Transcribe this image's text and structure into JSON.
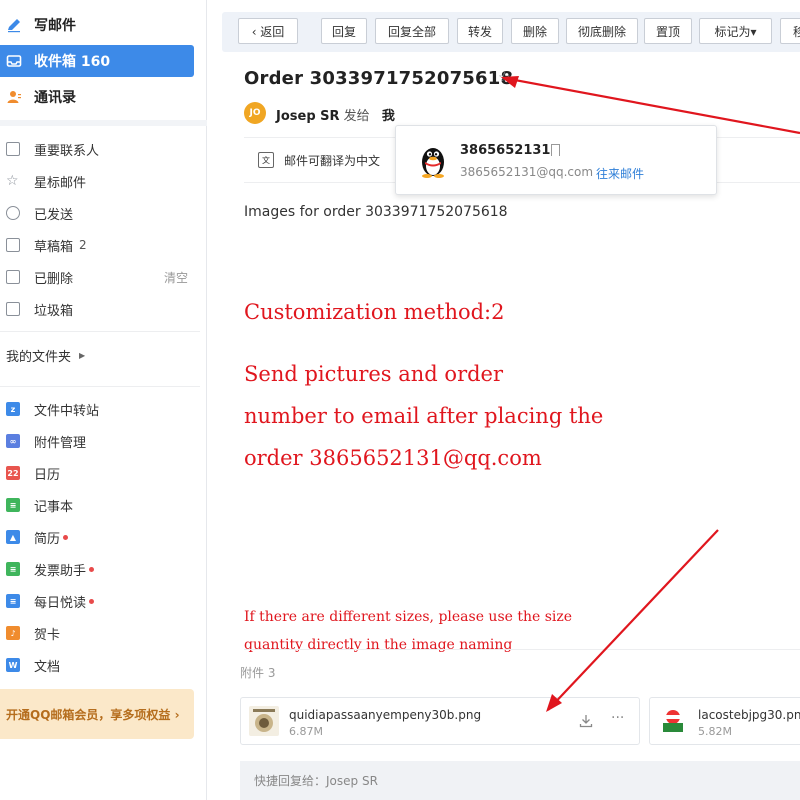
{
  "sidebar": {
    "compose": "写邮件",
    "inbox": "收件箱 160",
    "contacts": "通讯录",
    "folders": [
      {
        "label": "重要联系人",
        "count": "",
        "action": ""
      },
      {
        "label": "星标邮件",
        "count": "",
        "action": ""
      },
      {
        "label": "已发送",
        "count": "",
        "action": ""
      },
      {
        "label": "草稿箱",
        "count": "2",
        "action": ""
      },
      {
        "label": "已删除",
        "count": "",
        "action": "清空"
      },
      {
        "label": "垃圾箱",
        "count": "",
        "action": ""
      }
    ],
    "my_folders": "我的文件夹",
    "apps": [
      {
        "label": "文件中转站",
        "color": "#3d8ae8",
        "icon_text": "z"
      },
      {
        "label": "附件管理",
        "color": "#5b7fe0",
        "icon_text": "∞"
      },
      {
        "label": "日历",
        "color": "#e8554e",
        "icon_text": "22"
      },
      {
        "label": "记事本",
        "color": "#3fb55c",
        "icon_text": "≡"
      },
      {
        "label": "简历",
        "color": "#3d8ae8",
        "icon_text": "▲"
      },
      {
        "label": "发票助手",
        "color": "#3fb55c",
        "icon_text": "≡"
      },
      {
        "label": "每日悦读",
        "color": "#3d8ae8",
        "icon_text": "≡"
      },
      {
        "label": "贺卡",
        "color": "#f08c2e",
        "icon_text": "♪"
      },
      {
        "label": "文档",
        "color": "#3d8ae8",
        "icon_text": "W"
      }
    ],
    "vip_banner": "开通QQ邮箱会员，享多项权益 ›"
  },
  "toolbar": {
    "back": "‹ 返回",
    "reply": "回复",
    "reply_all": "回复全部",
    "forward": "转发",
    "delete": "删除",
    "delete_forever": "彻底删除",
    "pin": "置顶",
    "mark_as": "标记为▾",
    "move": "移"
  },
  "email": {
    "subject": "Order 3033971752075618",
    "sender_initials": "JO",
    "sender_name": "Josep SR",
    "sent_to": "发给",
    "recipient": "我",
    "translate": "邮件可翻译为中文",
    "body_line": "Images for order 3033971752075618",
    "red_lines": {
      "method": "Customization method:2",
      "send1": "Send pictures and order",
      "send2": "number to email after placing the",
      "send3": "order 3865652131@qq.com",
      "sizes1": "If there are different sizes, please use the size",
      "sizes2": "quantity directly in the image naming"
    }
  },
  "popup": {
    "name": "3865652131",
    "email": "3865652131@qq.com",
    "link": "往来邮件"
  },
  "attachments": {
    "heading": "附件 3",
    "items": [
      {
        "name": "quidiapassaanyempeny30b.png",
        "size": "6.87M"
      },
      {
        "name": "lacostebjpg30.png",
        "size": "5.82M"
      }
    ]
  },
  "quick_reply": "快捷回复给：Josep SR",
  "colors": {
    "accent": "#3d8ae8",
    "annotation_red": "#e0161e"
  }
}
